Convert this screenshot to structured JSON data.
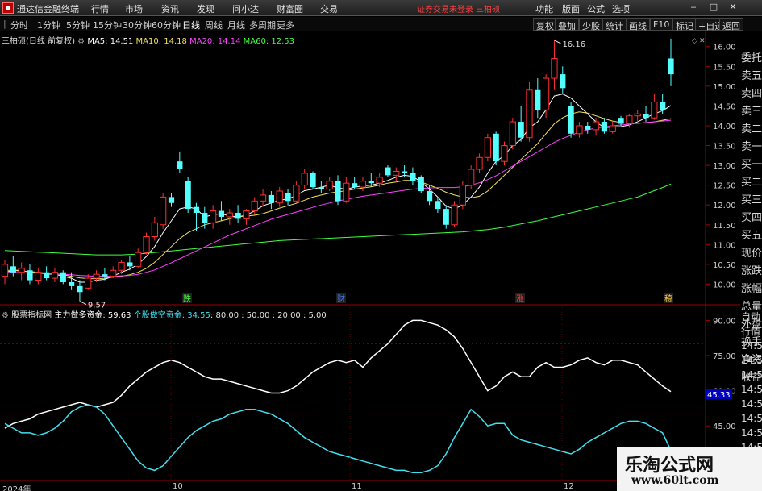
{
  "app": {
    "title": "通达信金融终端",
    "menus": [
      "行情",
      "市场",
      "资讯",
      "发现",
      "问小达",
      "财富圈",
      "交易"
    ],
    "login_status": "证券交易未登录",
    "stock_name": "三柏硕",
    "right_menus": [
      "功能",
      "版面",
      "公式",
      "选项"
    ],
    "window_buttons": [
      "‒",
      "□",
      "✕"
    ]
  },
  "toolbar": {
    "periods": [
      "分时",
      "1分钟",
      "5分钟",
      "15分钟",
      "30分钟",
      "60分钟",
      "日线",
      "周线",
      "月线",
      "多周期",
      "更多"
    ],
    "active_period": "日线",
    "tools": [
      "复权",
      "叠加",
      "少股",
      "统计",
      "画线",
      "F10",
      "标记",
      "+自选",
      "返回"
    ]
  },
  "kline_header": {
    "title": "三柏硕(日线 前复权)",
    "ma": [
      {
        "label": "MA5: 14.51",
        "color": "#ffffff"
      },
      {
        "label": "MA10: 14.18",
        "color": "#f0e060"
      },
      {
        "label": "MA20: 14.14",
        "color": "#ff40ff"
      },
      {
        "label": "MA60: 12.53",
        "color": "#40ff40"
      }
    ]
  },
  "indicator_header": {
    "name": "股票指标网",
    "series": [
      {
        "label": "主力做多资金: 59.63",
        "color": "#ffffff"
      },
      {
        "label": "个股做空资金: 34.55",
        "color": "#40e0f0"
      }
    ],
    "levels": ": 80.00 : 50.00 : 20.00 : 5.00"
  },
  "price_axis": [
    "16.00",
    "15.50",
    "15.00",
    "14.50",
    "14.00",
    "13.50",
    "13.00",
    "12.50",
    "12.00",
    "11.50",
    "11.00",
    "10.50",
    "10.00"
  ],
  "indicator_axis": [
    "90.00",
    "75.00",
    "60.00",
    "45.00",
    "30.00"
  ],
  "indicator_marker": "45.33",
  "annotations": {
    "high": "16.16",
    "low": "9.57"
  },
  "event_markers": [
    {
      "label": "跌",
      "color": "#40ff40"
    },
    {
      "label": "财",
      "color": "#4080ff"
    },
    {
      "label": "涨",
      "color": "#ff4040"
    },
    {
      "label": "稿",
      "color": "#ffd040"
    }
  ],
  "side_panel": [
    "委托",
    "卖五",
    "卖四",
    "卖三",
    "卖二",
    "卖一",
    "买一",
    "买二",
    "买三",
    "买四",
    "买五",
    "现价",
    "涨跌",
    "涨幅",
    "总量",
    "外盘",
    "换手",
    "净资",
    "收益"
  ],
  "side_panel_lower": [
    "自动",
    "行情",
    "14:50",
    "14:50",
    "14:50",
    "14:50",
    "14:50",
    "14:50",
    "14:50",
    "14:50"
  ],
  "date_labels": [
    "2024年",
    "10",
    "11",
    "12"
  ],
  "watermark": {
    "title": "乐淘公式网",
    "url": "www.60lt.com"
  },
  "chart_data": {
    "type": "candlestick",
    "price_range": [
      9.5,
      16.3
    ],
    "up_color": "#ff3030",
    "down_color": "#54ffff",
    "candles": [
      {
        "o": 10.2,
        "h": 10.6,
        "l": 10.0,
        "c": 10.5
      },
      {
        "o": 10.45,
        "h": 10.7,
        "l": 10.2,
        "c": 10.3
      },
      {
        "o": 10.3,
        "h": 10.55,
        "l": 10.1,
        "c": 10.4
      },
      {
        "o": 10.35,
        "h": 10.5,
        "l": 10.0,
        "c": 10.1
      },
      {
        "o": 10.1,
        "h": 10.4,
        "l": 10.0,
        "c": 10.3
      },
      {
        "o": 10.3,
        "h": 10.45,
        "l": 10.1,
        "c": 10.15
      },
      {
        "o": 10.15,
        "h": 10.4,
        "l": 10.05,
        "c": 10.3
      },
      {
        "o": 10.3,
        "h": 10.35,
        "l": 10.0,
        "c": 10.05
      },
      {
        "o": 10.05,
        "h": 10.3,
        "l": 9.85,
        "c": 9.95
      },
      {
        "o": 9.95,
        "h": 10.1,
        "l": 9.57,
        "c": 9.8
      },
      {
        "o": 9.9,
        "h": 10.25,
        "l": 9.85,
        "c": 10.15
      },
      {
        "o": 10.15,
        "h": 10.35,
        "l": 10.05,
        "c": 10.25
      },
      {
        "o": 10.25,
        "h": 10.4,
        "l": 10.1,
        "c": 10.2
      },
      {
        "o": 10.2,
        "h": 10.45,
        "l": 10.15,
        "c": 10.35
      },
      {
        "o": 10.35,
        "h": 10.6,
        "l": 10.25,
        "c": 10.55
      },
      {
        "o": 10.55,
        "h": 10.7,
        "l": 10.35,
        "c": 10.45
      },
      {
        "o": 10.45,
        "h": 10.9,
        "l": 10.4,
        "c": 10.8
      },
      {
        "o": 10.8,
        "h": 11.3,
        "l": 10.75,
        "c": 11.2
      },
      {
        "o": 11.2,
        "h": 11.7,
        "l": 11.1,
        "c": 11.55
      },
      {
        "o": 11.5,
        "h": 12.3,
        "l": 11.4,
        "c": 12.2
      },
      {
        "o": 12.2,
        "h": 12.3,
        "l": 11.95,
        "c": 12.05
      },
      {
        "o": 13.1,
        "h": 13.35,
        "l": 12.8,
        "c": 12.9
      },
      {
        "o": 12.6,
        "h": 12.7,
        "l": 11.8,
        "c": 11.9
      },
      {
        "o": 11.95,
        "h": 12.05,
        "l": 11.35,
        "c": 11.8
      },
      {
        "o": 11.8,
        "h": 11.95,
        "l": 11.4,
        "c": 11.55
      },
      {
        "o": 11.55,
        "h": 12.0,
        "l": 11.4,
        "c": 11.85
      },
      {
        "o": 11.85,
        "h": 12.1,
        "l": 11.6,
        "c": 11.7
      },
      {
        "o": 11.7,
        "h": 11.9,
        "l": 11.5,
        "c": 11.8
      },
      {
        "o": 11.8,
        "h": 12.0,
        "l": 11.55,
        "c": 11.65
      },
      {
        "o": 11.65,
        "h": 11.9,
        "l": 11.5,
        "c": 11.85
      },
      {
        "o": 11.85,
        "h": 12.2,
        "l": 11.75,
        "c": 12.1
      },
      {
        "o": 12.1,
        "h": 12.4,
        "l": 11.95,
        "c": 12.25
      },
      {
        "o": 12.25,
        "h": 12.35,
        "l": 11.9,
        "c": 12.05
      },
      {
        "o": 12.05,
        "h": 12.45,
        "l": 11.95,
        "c": 12.35
      },
      {
        "o": 12.3,
        "h": 12.4,
        "l": 12.0,
        "c": 12.1
      },
      {
        "o": 12.1,
        "h": 12.6,
        "l": 12.05,
        "c": 12.5
      },
      {
        "o": 12.5,
        "h": 12.9,
        "l": 12.4,
        "c": 12.8
      },
      {
        "o": 12.8,
        "h": 12.85,
        "l": 12.4,
        "c": 12.45
      },
      {
        "o": 12.45,
        "h": 12.6,
        "l": 12.3,
        "c": 12.4
      },
      {
        "o": 12.4,
        "h": 12.7,
        "l": 12.35,
        "c": 12.6
      },
      {
        "o": 12.6,
        "h": 12.75,
        "l": 12.0,
        "c": 12.1
      },
      {
        "o": 12.1,
        "h": 12.7,
        "l": 12.05,
        "c": 12.55
      },
      {
        "o": 12.55,
        "h": 12.7,
        "l": 12.4,
        "c": 12.45
      },
      {
        "o": 12.45,
        "h": 12.7,
        "l": 12.35,
        "c": 12.6
      },
      {
        "o": 12.6,
        "h": 12.8,
        "l": 12.45,
        "c": 12.55
      },
      {
        "o": 12.55,
        "h": 12.8,
        "l": 12.45,
        "c": 12.7
      },
      {
        "o": 12.95,
        "h": 13.0,
        "l": 12.7,
        "c": 12.75
      },
      {
        "o": 12.75,
        "h": 12.95,
        "l": 12.6,
        "c": 12.85
      },
      {
        "o": 12.85,
        "h": 13.0,
        "l": 12.7,
        "c": 12.8
      },
      {
        "o": 12.8,
        "h": 12.95,
        "l": 12.5,
        "c": 12.6
      },
      {
        "o": 12.7,
        "h": 12.75,
        "l": 12.3,
        "c": 12.35
      },
      {
        "o": 12.35,
        "h": 12.5,
        "l": 12.0,
        "c": 12.1
      },
      {
        "o": 12.1,
        "h": 12.2,
        "l": 11.8,
        "c": 11.9
      },
      {
        "o": 11.9,
        "h": 12.0,
        "l": 11.4,
        "c": 11.5
      },
      {
        "o": 11.5,
        "h": 12.1,
        "l": 11.45,
        "c": 12.0
      },
      {
        "o": 12.0,
        "h": 12.6,
        "l": 11.9,
        "c": 12.5
      },
      {
        "o": 12.5,
        "h": 13.0,
        "l": 12.4,
        "c": 12.9
      },
      {
        "o": 12.9,
        "h": 13.3,
        "l": 12.8,
        "c": 13.2
      },
      {
        "o": 13.2,
        "h": 13.8,
        "l": 13.1,
        "c": 13.7
      },
      {
        "o": 13.8,
        "h": 13.85,
        "l": 13.0,
        "c": 13.1
      },
      {
        "o": 13.1,
        "h": 13.6,
        "l": 13.0,
        "c": 13.5
      },
      {
        "o": 13.5,
        "h": 14.2,
        "l": 13.4,
        "c": 14.1
      },
      {
        "o": 14.1,
        "h": 14.5,
        "l": 13.6,
        "c": 13.7
      },
      {
        "o": 13.7,
        "h": 15.1,
        "l": 13.6,
        "c": 14.9
      },
      {
        "o": 14.9,
        "h": 15.2,
        "l": 14.2,
        "c": 14.4
      },
      {
        "o": 14.4,
        "h": 15.3,
        "l": 14.2,
        "c": 15.2
      },
      {
        "o": 15.2,
        "h": 16.16,
        "l": 14.9,
        "c": 15.7
      },
      {
        "o": 15.3,
        "h": 15.5,
        "l": 14.8,
        "c": 14.95
      },
      {
        "o": 14.5,
        "h": 14.6,
        "l": 13.7,
        "c": 13.8
      },
      {
        "o": 13.8,
        "h": 14.1,
        "l": 13.7,
        "c": 14.0
      },
      {
        "o": 14.0,
        "h": 14.1,
        "l": 13.8,
        "c": 13.9
      },
      {
        "o": 13.9,
        "h": 14.2,
        "l": 13.75,
        "c": 14.1
      },
      {
        "o": 14.1,
        "h": 14.2,
        "l": 13.8,
        "c": 13.85
      },
      {
        "o": 13.85,
        "h": 14.1,
        "l": 13.8,
        "c": 14.0
      },
      {
        "o": 14.2,
        "h": 14.25,
        "l": 14.0,
        "c": 14.05
      },
      {
        "o": 14.05,
        "h": 14.3,
        "l": 13.95,
        "c": 14.25
      },
      {
        "o": 14.25,
        "h": 14.4,
        "l": 14.1,
        "c": 14.3
      },
      {
        "o": 14.3,
        "h": 14.5,
        "l": 14.1,
        "c": 14.2
      },
      {
        "o": 14.2,
        "h": 14.8,
        "l": 14.15,
        "c": 14.6
      },
      {
        "o": 14.6,
        "h": 14.8,
        "l": 14.3,
        "c": 14.4
      },
      {
        "o": 15.7,
        "h": 16.2,
        "l": 15.0,
        "c": 15.3
      }
    ],
    "ma_series": [
      {
        "name": "MA5",
        "color": "#ffffff",
        "values": [
          10.3,
          10.35,
          10.35,
          10.3,
          10.28,
          10.26,
          10.25,
          10.2,
          10.15,
          10.05,
          10.05,
          10.1,
          10.12,
          10.2,
          10.3,
          10.38,
          10.5,
          10.7,
          10.95,
          11.3,
          11.6,
          11.9,
          11.95,
          11.9,
          11.7,
          11.75,
          11.78,
          11.72,
          11.7,
          11.74,
          11.85,
          11.98,
          12.05,
          12.12,
          12.15,
          12.24,
          12.36,
          12.4,
          12.45,
          12.5,
          12.43,
          12.4,
          12.45,
          12.48,
          12.5,
          12.55,
          12.62,
          12.7,
          12.75,
          12.72,
          12.58,
          12.4,
          12.2,
          11.97,
          11.9,
          12.0,
          12.2,
          12.45,
          12.8,
          13.1,
          13.25,
          13.5,
          13.65,
          13.95,
          14.1,
          14.4,
          14.75,
          14.8,
          14.7,
          14.5,
          14.3,
          14.1,
          13.95,
          13.97,
          13.98,
          14.02,
          14.1,
          14.2,
          14.3,
          14.38,
          14.51
        ]
      },
      {
        "name": "MA10",
        "color": "#f0e060",
        "values": [
          10.35,
          10.35,
          10.33,
          10.32,
          10.3,
          10.28,
          10.26,
          10.24,
          10.2,
          10.16,
          10.14,
          10.14,
          10.15,
          10.18,
          10.2,
          10.24,
          10.3,
          10.4,
          10.55,
          10.75,
          10.95,
          11.15,
          11.3,
          11.4,
          11.5,
          11.55,
          11.6,
          11.65,
          11.7,
          11.72,
          11.74,
          11.78,
          11.85,
          11.92,
          11.98,
          12.04,
          12.12,
          12.2,
          12.25,
          12.3,
          12.33,
          12.36,
          12.4,
          12.43,
          12.46,
          12.5,
          12.55,
          12.58,
          12.62,
          12.62,
          12.58,
          12.5,
          12.42,
          12.32,
          12.25,
          12.2,
          12.18,
          12.22,
          12.35,
          12.55,
          12.75,
          12.95,
          13.15,
          13.35,
          13.55,
          13.8,
          14.05,
          14.2,
          14.3,
          14.35,
          14.32,
          14.25,
          14.18,
          14.12,
          14.08,
          14.06,
          14.06,
          14.08,
          14.1,
          14.14,
          14.18
        ]
      },
      {
        "name": "MA20",
        "color": "#ff40ff",
        "values": [
          10.3,
          10.3,
          10.29,
          10.28,
          10.28,
          10.27,
          10.26,
          10.25,
          10.24,
          10.22,
          10.21,
          10.2,
          10.2,
          10.2,
          10.21,
          10.22,
          10.25,
          10.3,
          10.36,
          10.45,
          10.54,
          10.64,
          10.74,
          10.84,
          10.94,
          11.04,
          11.14,
          11.24,
          11.32,
          11.4,
          11.48,
          11.56,
          11.64,
          11.7,
          11.76,
          11.82,
          11.88,
          11.94,
          12.0,
          12.05,
          12.1,
          12.14,
          12.18,
          12.22,
          12.25,
          12.28,
          12.31,
          12.34,
          12.37,
          12.4,
          12.42,
          12.43,
          12.44,
          12.44,
          12.44,
          12.46,
          12.5,
          12.56,
          12.64,
          12.74,
          12.86,
          12.98,
          13.1,
          13.22,
          13.34,
          13.46,
          13.58,
          13.68,
          13.76,
          13.84,
          13.9,
          13.94,
          13.97,
          14.0,
          14.02,
          14.04,
          14.06,
          14.08,
          14.1,
          14.12,
          14.14
        ]
      },
      {
        "name": "MA60",
        "color": "#40ff40",
        "values": [
          10.85,
          10.84,
          10.83,
          10.82,
          10.81,
          10.8,
          10.79,
          10.78,
          10.77,
          10.76,
          10.75,
          10.74,
          10.74,
          10.74,
          10.74,
          10.75,
          10.76,
          10.78,
          10.8,
          10.82,
          10.84,
          10.86,
          10.88,
          10.9,
          10.92,
          10.94,
          10.96,
          10.98,
          11.0,
          11.02,
          11.04,
          11.06,
          11.08,
          11.1,
          11.11,
          11.12,
          11.13,
          11.14,
          11.15,
          11.16,
          11.17,
          11.18,
          11.19,
          11.2,
          11.21,
          11.22,
          11.23,
          11.24,
          11.25,
          11.26,
          11.27,
          11.28,
          11.29,
          11.3,
          11.31,
          11.32,
          11.34,
          11.36,
          11.38,
          11.41,
          11.44,
          11.48,
          11.52,
          11.56,
          11.6,
          11.65,
          11.7,
          11.75,
          11.8,
          11.85,
          11.9,
          11.95,
          12.0,
          12.05,
          12.1,
          12.15,
          12.2,
          12.28,
          12.36,
          12.44,
          12.53
        ]
      }
    ],
    "indicator": {
      "range": [
        22,
        96
      ],
      "series": [
        {
          "name": "主力做多资金",
          "color": "#ffffff",
          "values": [
            44,
            46,
            47,
            48,
            50,
            51,
            52,
            53,
            54,
            55,
            54,
            53,
            54,
            55,
            58,
            62,
            65,
            68,
            70,
            72,
            73,
            72,
            70,
            68,
            66,
            65,
            65,
            64,
            63,
            62,
            61,
            60,
            59,
            59,
            60,
            62,
            65,
            68,
            70,
            72,
            73,
            72,
            73,
            70,
            74,
            77,
            80,
            84,
            88,
            90,
            90,
            89,
            88,
            86,
            83,
            78,
            72,
            66,
            60,
            62,
            66,
            68,
            66,
            66,
            70,
            72,
            70,
            70,
            71,
            73,
            74,
            72,
            71,
            73,
            73,
            72,
            71,
            68,
            65,
            62,
            59.63
          ]
        },
        {
          "name": "个股做空资金",
          "color": "#40e0f0",
          "values": [
            46,
            44,
            42,
            42,
            41,
            42,
            44,
            47,
            51,
            53,
            54,
            53,
            50,
            45,
            40,
            35,
            30,
            27,
            26,
            28,
            32,
            36,
            40,
            43,
            45,
            47,
            48,
            50,
            51,
            52,
            52,
            51,
            50,
            48,
            46,
            43,
            40,
            38,
            36,
            34,
            33,
            32,
            31,
            30,
            29,
            28,
            27,
            26,
            26,
            25,
            25,
            26,
            28,
            33,
            40,
            46,
            52,
            49,
            45,
            46,
            46,
            41,
            39,
            38,
            37,
            36,
            35,
            34,
            33,
            35,
            38,
            40,
            42,
            44,
            46,
            47,
            47,
            46,
            44,
            42,
            34.55
          ]
        }
      ]
    }
  }
}
